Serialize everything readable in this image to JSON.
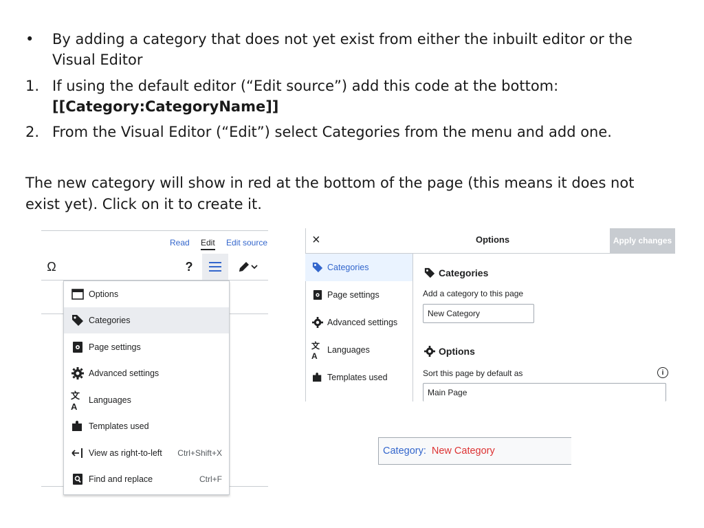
{
  "slide": {
    "bullet_symbol": "•",
    "bullet_line1": "By adding a category that does not yet exist from either the inbuilt editor or the",
    "bullet_line2": "Visual Editor",
    "item1_number": "1.",
    "item1_line1": "If using the default editor (“Edit source”) add this code at the bottom:",
    "item1_code": "[[Category:CategoryName]]",
    "item2_number": "2.",
    "item2_line1": "From the Visual Editor (“Edit”) select Categories from the menu and add one.",
    "para_line1": "The new category will show in red at the bottom of the page (this means it does not",
    "para_line2": "exist yet). Click on it to create it."
  },
  "editor": {
    "tabs": [
      {
        "label": "Read"
      },
      {
        "label": "Edit"
      },
      {
        "label": "Edit source"
      }
    ],
    "toolbar": {
      "special_char_glyph": "Ω",
      "help_glyph": "?"
    },
    "menu": [
      {
        "label": "Options",
        "icon": "window-icon",
        "shortcut": ""
      },
      {
        "label": "Categories",
        "icon": "tag-icon",
        "shortcut": ""
      },
      {
        "label": "Page settings",
        "icon": "page-settings-icon",
        "shortcut": ""
      },
      {
        "label": "Advanced settings",
        "icon": "gear-icon",
        "shortcut": ""
      },
      {
        "label": "Languages",
        "icon": "language-icon",
        "shortcut": ""
      },
      {
        "label": "Templates used",
        "icon": "puzzle-icon",
        "shortcut": ""
      },
      {
        "label": "View as right-to-left",
        "icon": "rtl-icon",
        "shortcut": "Ctrl+Shift+X"
      },
      {
        "label": "Find and replace",
        "icon": "find-icon",
        "shortcut": "Ctrl+F"
      }
    ]
  },
  "dialog": {
    "close_glyph": "×",
    "title": "Options",
    "apply_label": "Apply changes",
    "nav": [
      {
        "label": "Categories",
        "icon": "tag-icon"
      },
      {
        "label": "Page settings",
        "icon": "page-settings-icon"
      },
      {
        "label": "Advanced settings",
        "icon": "gear-icon"
      },
      {
        "label": "Languages",
        "icon": "language-icon"
      },
      {
        "label": "Templates used",
        "icon": "puzzle-icon"
      }
    ],
    "categories_title": "Categories",
    "add_category_label": "Add a category to this page",
    "category_input_value": "New Category",
    "options_title": "Options",
    "sort_label": "Sort this page by default as",
    "info_glyph": "i",
    "sort_input_value": "Main Page"
  },
  "catlinks": {
    "prefix": "Category:",
    "link": "New Category"
  },
  "colors": {
    "link_blue": "#3366cc",
    "redlink": "#dd3333",
    "border_gray": "#c8ccd1"
  }
}
